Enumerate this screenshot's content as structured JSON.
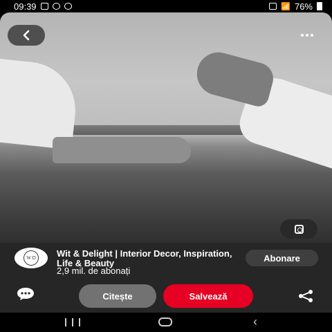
{
  "status_bar": {
    "time": "09:39",
    "battery": "76%"
  },
  "icons": {
    "back": "chevron-left-icon",
    "more": "more-dots-icon",
    "lens": "visual-search-icon",
    "comment": "comment-icon",
    "share": "share-icon"
  },
  "profile": {
    "avatar_text": "W D",
    "name": "Wit & Delight | Interior Decor, Inspiration, Life & Beauty",
    "followers": "2,9 mil. de abonați",
    "follow_label": "Abonare"
  },
  "actions": {
    "read_label": "Citește",
    "save_label": "Salvează"
  },
  "colors": {
    "save_red": "#e60023",
    "panel": "#262626",
    "read_gray": "#727272"
  }
}
